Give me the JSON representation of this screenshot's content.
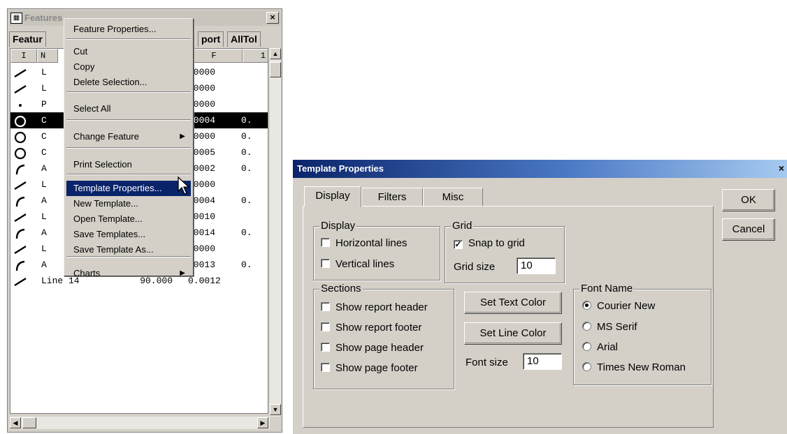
{
  "features_window": {
    "title": "Features",
    "close_glyph": "×",
    "tabs": [
      "Featur",
      "port",
      "AllTol"
    ],
    "columns": [
      "I",
      "N",
      "F",
      "1"
    ],
    "rows": [
      {
        "icon": "line-icon",
        "name": "L",
        "v1": "",
        "v2": ".0000",
        "v3": "",
        "selected": false
      },
      {
        "icon": "line-icon",
        "name": "L",
        "v1": "",
        "v2": ".0000",
        "v3": "",
        "selected": false
      },
      {
        "icon": "point-icon",
        "name": "P",
        "v1": "",
        "v2": ".0000",
        "v3": "",
        "selected": false
      },
      {
        "icon": "circle-icon",
        "name": "C",
        "v1": "",
        "v2": ".0004",
        "v3": "0.",
        "selected": true
      },
      {
        "icon": "circle-icon",
        "name": "C",
        "v1": "",
        "v2": ".0000",
        "v3": "0.",
        "selected": false
      },
      {
        "icon": "circle-icon",
        "name": "C",
        "v1": "",
        "v2": ".0005",
        "v3": "0.",
        "selected": false
      },
      {
        "icon": "arc-icon",
        "name": "A",
        "v1": "",
        "v2": ".0002",
        "v3": "0.",
        "selected": false
      },
      {
        "icon": "line-icon",
        "name": "L",
        "v1": "",
        "v2": ".0000",
        "v3": "",
        "selected": false
      },
      {
        "icon": "arc-icon",
        "name": "A",
        "v1": "",
        "v2": ".0004",
        "v3": "0.",
        "selected": false
      },
      {
        "icon": "line-icon",
        "name": "L",
        "v1": "",
        "v2": ".0010",
        "v3": "",
        "selected": false
      },
      {
        "icon": "arc-icon",
        "name": "A",
        "v1": "",
        "v2": ".0014",
        "v3": "0.",
        "selected": false
      },
      {
        "icon": "line-icon",
        "name": "L",
        "v1": "",
        "v2": ".0000",
        "v3": "",
        "selected": false
      },
      {
        "icon": "arc-icon",
        "name": "A",
        "v1": "",
        "v2": ".0013",
        "v3": "0.",
        "selected": false
      },
      {
        "icon": "line-icon",
        "name": "Line 14",
        "v1": "90.000",
        "v2": "0.0012",
        "v3": "",
        "selected": false
      }
    ]
  },
  "context_menu": {
    "items": [
      {
        "label": "Feature Properties...",
        "highlight": false,
        "submenu": false
      },
      {
        "sep": true
      },
      {
        "label": "Cut",
        "highlight": false,
        "submenu": false
      },
      {
        "label": "Copy",
        "highlight": false,
        "submenu": false
      },
      {
        "label": "Delete Selection...",
        "highlight": false,
        "submenu": false
      },
      {
        "sep": true
      },
      {
        "label": "Select All",
        "highlight": false,
        "submenu": false
      },
      {
        "sep": true
      },
      {
        "label": "Change Feature",
        "highlight": false,
        "submenu": true
      },
      {
        "sep": true
      },
      {
        "label": "Print Selection",
        "highlight": false,
        "submenu": false
      },
      {
        "sep": true
      },
      {
        "label": "Template Properties...",
        "highlight": true,
        "submenu": false
      },
      {
        "label": "New Template...",
        "highlight": false,
        "submenu": false
      },
      {
        "label": "Open Template...",
        "highlight": false,
        "submenu": false
      },
      {
        "label": "Save Templates...",
        "highlight": false,
        "submenu": false
      },
      {
        "label": "Save Template As...",
        "highlight": false,
        "submenu": false
      },
      {
        "sep": true
      },
      {
        "label": "Charts",
        "highlight": false,
        "submenu": true
      }
    ]
  },
  "template_dialog": {
    "title": "Template Properties",
    "close_glyph": "×",
    "tabs": [
      "Display",
      "Filters",
      "Misc"
    ],
    "active_tab": "Display",
    "ok_label": "OK",
    "cancel_label": "Cancel",
    "display_group": {
      "legend": "Display",
      "horizontal_lines": {
        "label": "Horizontal lines",
        "checked": false
      },
      "vertical_lines": {
        "label": "Vertical lines",
        "checked": false
      }
    },
    "grid_group": {
      "legend": "Grid",
      "snap_to_grid": {
        "label": "Snap to grid",
        "checked": true
      },
      "grid_size_label": "Grid size",
      "grid_size_value": "10"
    },
    "sections_group": {
      "legend": "Sections",
      "show_report_header": {
        "label": "Show report header",
        "checked": false
      },
      "show_report_footer": {
        "label": "Show report footer",
        "checked": false
      },
      "show_page_header": {
        "label": "Show page header",
        "checked": false
      },
      "show_page_footer": {
        "label": "Show page footer",
        "checked": false
      }
    },
    "set_text_color_label": "Set Text Color",
    "set_line_color_label": "Set Line Color",
    "font_size_label": "Font size",
    "font_size_value": "10",
    "font_name_group": {
      "legend": "Font Name",
      "options": [
        "Courier New",
        "MS Serif",
        "Arial",
        "Times New Roman"
      ],
      "selected": "Courier New"
    }
  },
  "colors": {
    "window_face": "#d4d0c8",
    "selection": "#0a246a",
    "title_gradient_start": "#0a246a",
    "title_gradient_end": "#a6caf0"
  }
}
